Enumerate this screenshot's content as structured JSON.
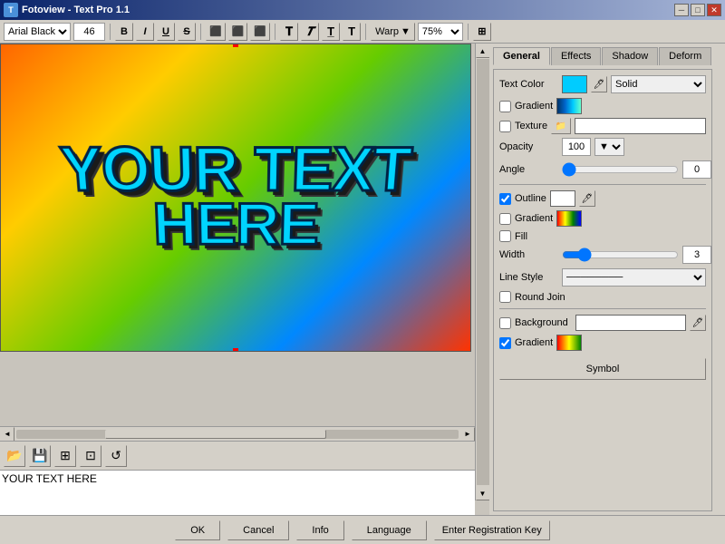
{
  "titlebar": {
    "title": "Fotoview - Text Pro 1.1",
    "icon": "T"
  },
  "toolbar": {
    "font_family": "Arial Black",
    "font_size": "46",
    "bold_label": "B",
    "italic_label": "I",
    "underline_label": "U",
    "strikethrough_label": "S",
    "align_left": "≡",
    "align_center": "≡",
    "align_right": "≡",
    "text_btn1": "T",
    "text_btn2": "T",
    "text_btn3": "T",
    "text_btn4": "T",
    "warp_label": "Warp",
    "zoom_label": "75%"
  },
  "canvas": {
    "text": "YOUR TEXT HERE"
  },
  "tabs": [
    {
      "id": "general",
      "label": "General",
      "active": true
    },
    {
      "id": "effects",
      "label": "Effects"
    },
    {
      "id": "shadow",
      "label": "Shadow"
    },
    {
      "id": "deform",
      "label": "Deform"
    }
  ],
  "general": {
    "text_color_label": "Text Color",
    "text_color_type": "Solid",
    "gradient_label": "Gradient",
    "texture_label": "Texture",
    "opacity_label": "Opacity",
    "opacity_value": "100",
    "angle_label": "Angle",
    "angle_value": "0",
    "outline_label": "Outline",
    "outline_gradient_label": "Gradient",
    "fill_label": "Fill",
    "width_label": "Width",
    "width_value": "3",
    "line_style_label": "Line Style",
    "round_join_label": "Round Join",
    "background_label": "Background",
    "bg_gradient_label": "Gradient",
    "symbol_btn": "Symbol"
  },
  "bottom": {
    "ok": "OK",
    "cancel": "Cancel",
    "info": "Info",
    "language": "Language",
    "register": "Enter Registration Key"
  }
}
